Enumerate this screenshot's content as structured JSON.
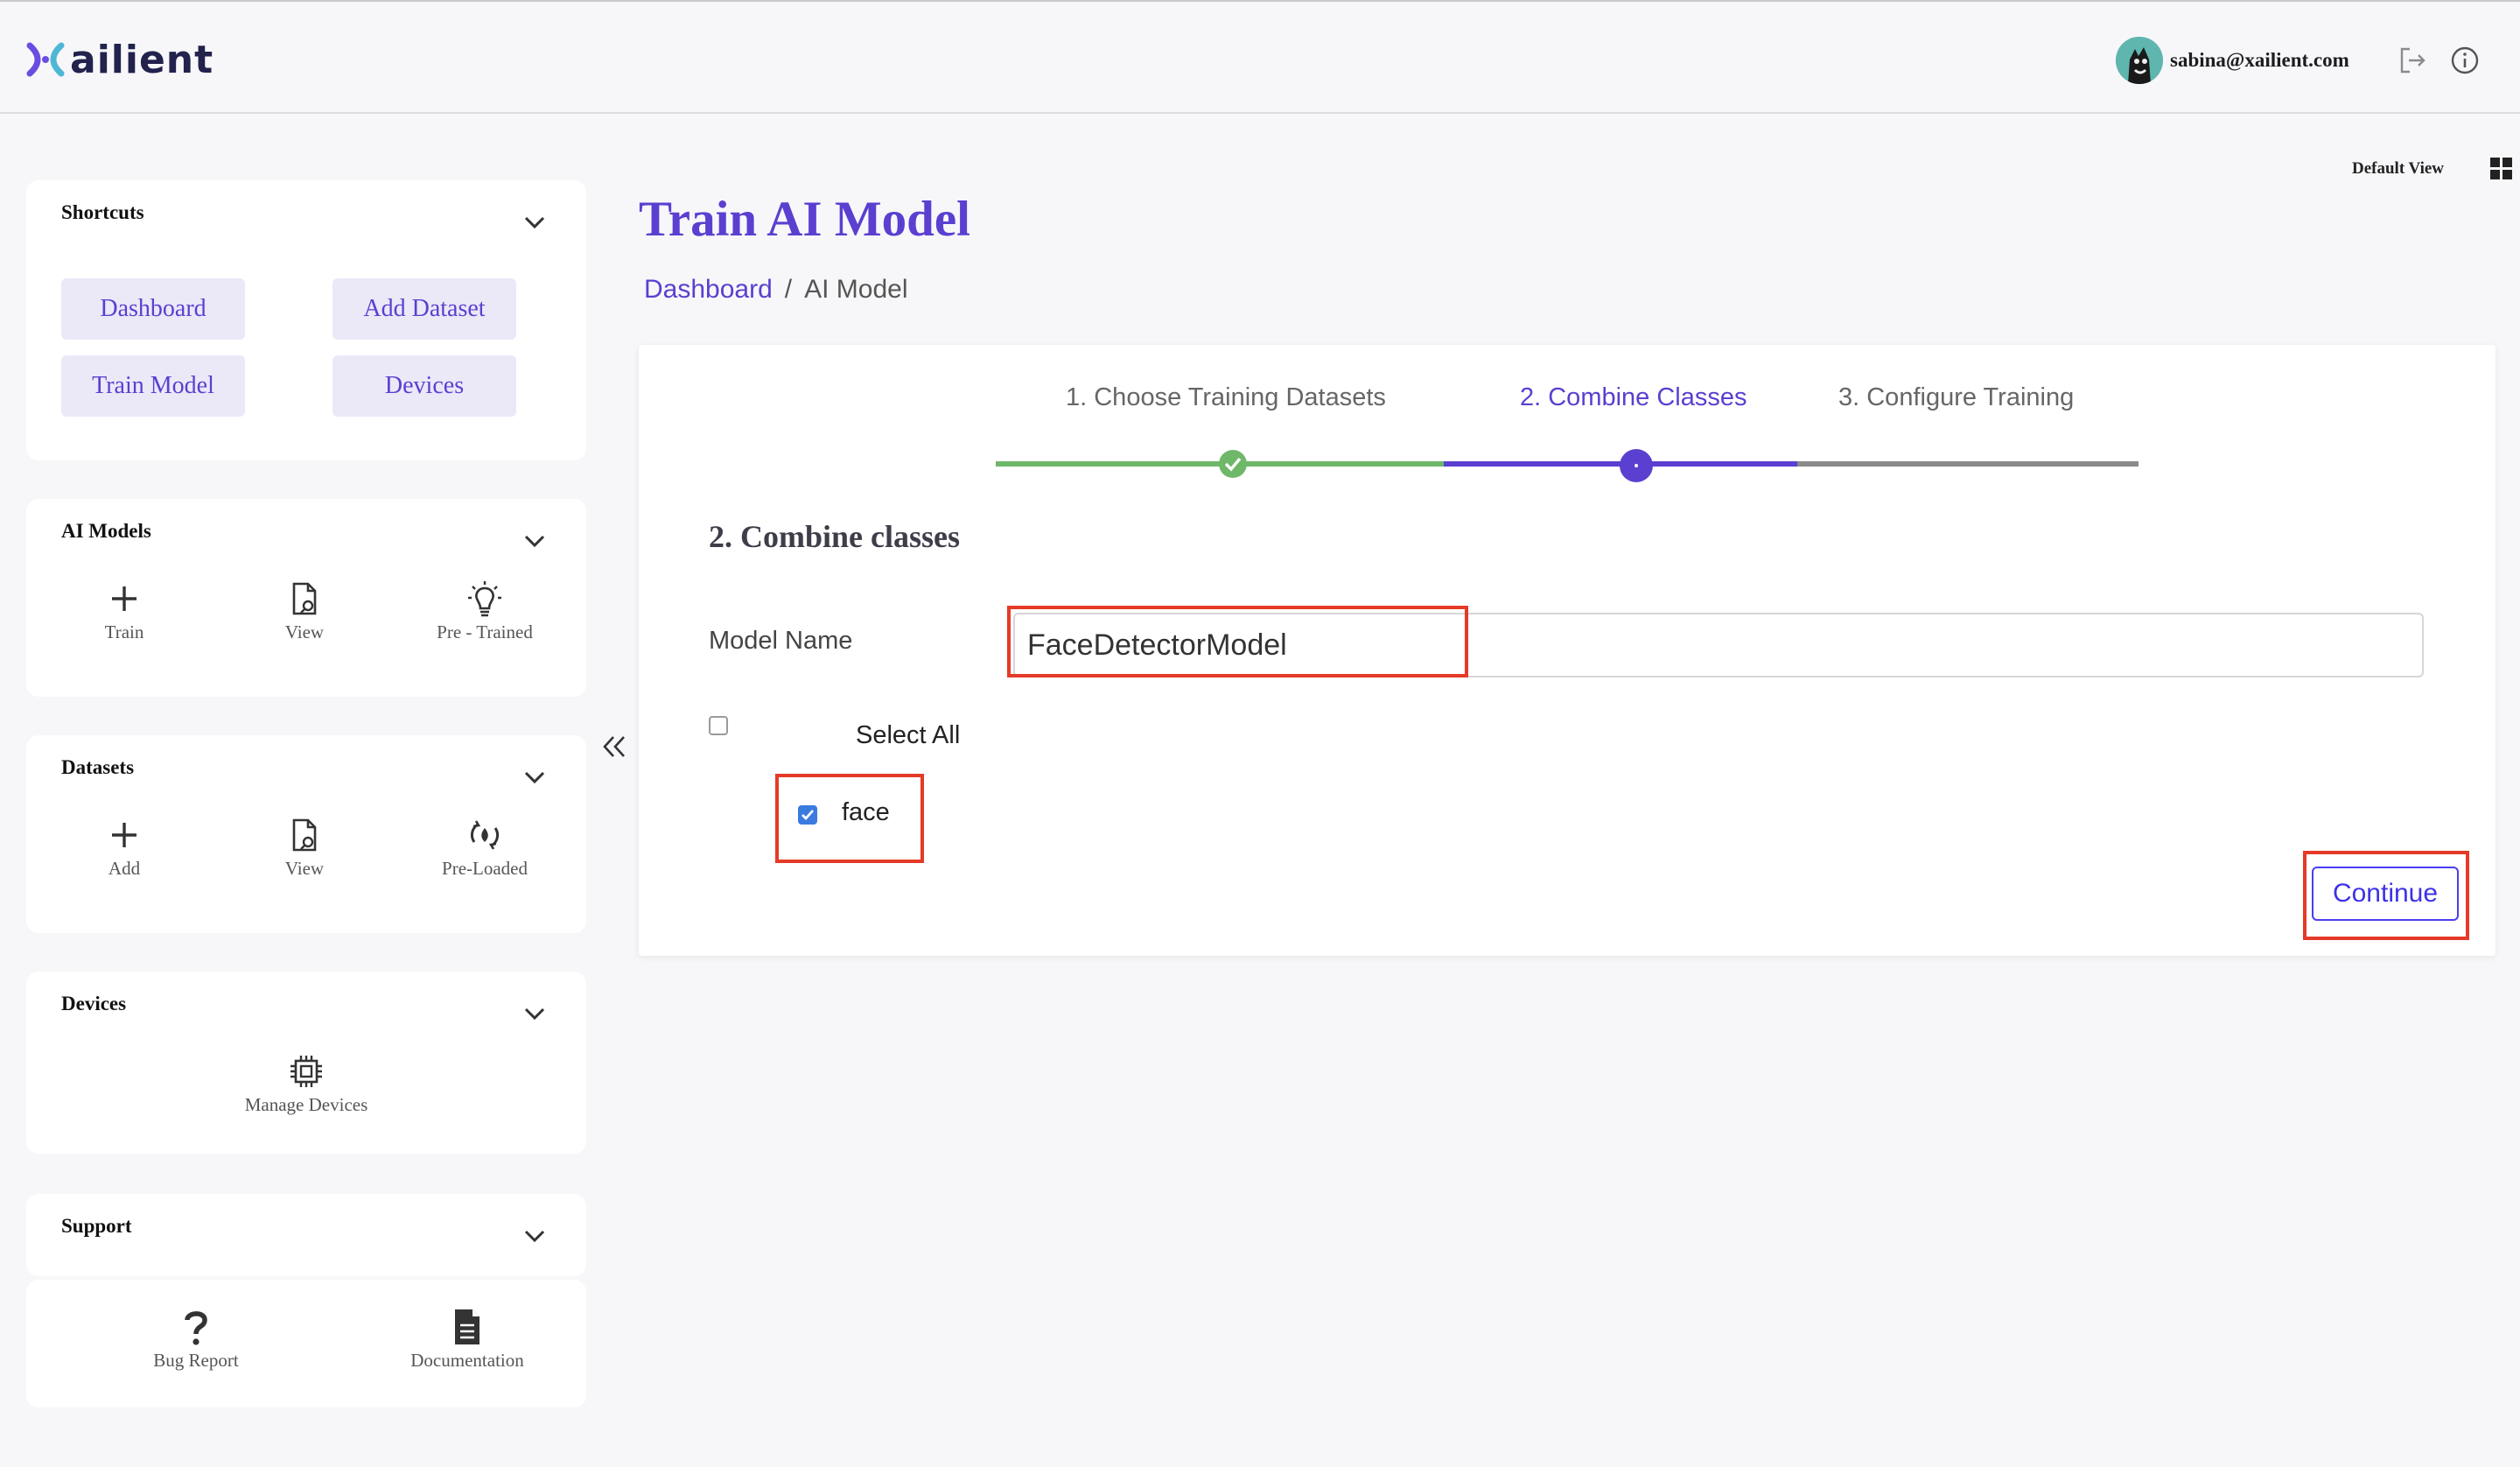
{
  "app": {
    "logo_text": "ailient"
  },
  "header": {
    "user_email": "sabina@xailient.com",
    "logout_icon": "logout-icon",
    "info_icon": "info-icon",
    "default_view_label": "Default View",
    "grid_icon": "grid-view-icon"
  },
  "sidebar": {
    "shortcuts": {
      "title": "Shortcuts",
      "buttons": [
        "Dashboard",
        "Add Dataset",
        "Train Model",
        "Devices"
      ]
    },
    "ai_models": {
      "title": "AI Models",
      "items": [
        {
          "label": "Train",
          "icon": "plus-icon"
        },
        {
          "label": "View",
          "icon": "file-view-icon"
        },
        {
          "label": "Pre - Trained",
          "icon": "lightbulb-icon"
        }
      ]
    },
    "datasets": {
      "title": "Datasets",
      "items": [
        {
          "label": "Add",
          "icon": "plus-icon"
        },
        {
          "label": "View",
          "icon": "file-view-icon"
        },
        {
          "label": "Pre-Loaded",
          "icon": "preloaded-icon"
        }
      ]
    },
    "devices": {
      "title": "Devices",
      "items": [
        {
          "label": "Manage Devices",
          "icon": "chip-icon"
        }
      ]
    },
    "support": {
      "title": "Support",
      "items": [
        {
          "label": "Bug Report",
          "icon": "question-icon"
        },
        {
          "label": "Documentation",
          "icon": "document-icon"
        }
      ]
    }
  },
  "main": {
    "title": "Train AI Model",
    "breadcrumb": {
      "home": "Dashboard",
      "separator": "/",
      "current": "AI Model"
    },
    "steps": [
      {
        "label": "1. Choose Training Datasets",
        "state": "complete"
      },
      {
        "label": "2. Combine Classes",
        "state": "active"
      },
      {
        "label": "3. Configure Training",
        "state": "pending"
      }
    ],
    "section_title": "2. Combine classes",
    "model_name_label": "Model Name",
    "model_name_value": "FaceDetectorModel",
    "select_all_label": "Select All",
    "select_all_checked": false,
    "classes": [
      {
        "label": "face",
        "checked": true
      }
    ],
    "continue_label": "Continue"
  },
  "colors": {
    "brand_purple": "#5b3fd0",
    "complete_green": "#6fb769",
    "pending_gray": "#8a8a8a",
    "highlight_red": "#e53a28",
    "checkbox_blue": "#3b7be0"
  }
}
